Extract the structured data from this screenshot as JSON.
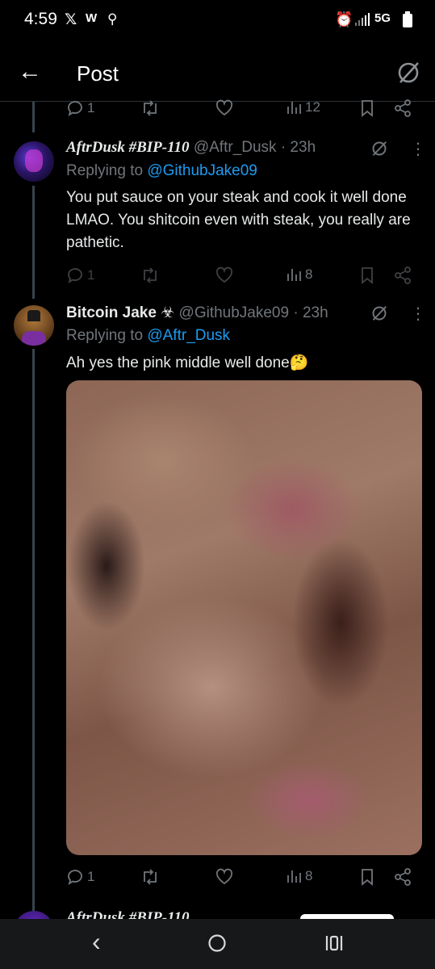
{
  "status_bar": {
    "time": "4:59",
    "network": "5G"
  },
  "header": {
    "title": "Post"
  },
  "top_actions": {
    "replies": "1",
    "views": "12"
  },
  "tweets": [
    {
      "display_name": "AftrDusk #BIP-110",
      "handle": "@Aftr_Dusk",
      "time": "· 23h",
      "replying_prefix": "Replying to",
      "replying_to": "@GithubJake09",
      "text": "You put sauce on your steak and cook it well done LMAO. You shitcoin even with steak, you really are pathetic.",
      "replies": "1",
      "views": "8"
    },
    {
      "display_name": "Bitcoin Jake ☣",
      "handle": "@GithubJake09",
      "time": "· 23h",
      "replying_prefix": "Replying to",
      "replying_to": "@Aftr_Dusk",
      "text": "Ah yes the pink middle well done🤔",
      "replies": "1",
      "views": "8"
    }
  ],
  "peek": {
    "display_name": "AftrDusk #BIP-110"
  },
  "icons": {
    "back": "arrow-left-icon",
    "grok": "grok-icon",
    "reply": "comment-icon",
    "retweet": "retweet-icon",
    "like": "heart-icon",
    "views": "views-icon",
    "bookmark": "bookmark-icon",
    "share": "share-icon"
  },
  "colors": {
    "link": "#1d9bf0",
    "muted": "#71767b",
    "text": "#e7e9ea",
    "background": "#000000"
  }
}
